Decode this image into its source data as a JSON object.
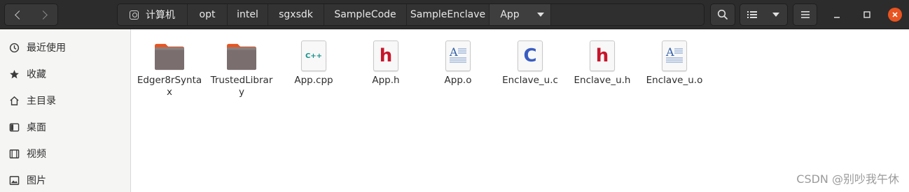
{
  "header": {
    "breadcrumbs": [
      "计算机",
      "opt",
      "intel",
      "sgxsdk",
      "SampleCode",
      "SampleEnclave",
      "App"
    ],
    "icons": {
      "back": "chevron-left-icon",
      "forward": "chevron-right-icon",
      "location_menu": "caret-down-icon",
      "search": "search-icon",
      "view": "list-view-icon",
      "view_menu": "caret-down-icon",
      "menu": "hamburger-menu-icon",
      "minimize": "minimize-icon",
      "maximize": "maximize-icon",
      "close": "close-icon"
    },
    "close_color": "#e95420"
  },
  "sidebar": {
    "items": [
      {
        "label": "最近使用",
        "icon": "clock-icon"
      },
      {
        "label": "收藏",
        "icon": "star-icon"
      },
      {
        "label": "主目录",
        "icon": "home-icon"
      },
      {
        "label": "桌面",
        "icon": "desktop-icon"
      },
      {
        "label": "视频",
        "icon": "video-icon"
      },
      {
        "label": "图片",
        "icon": "picture-icon"
      }
    ]
  },
  "files": [
    {
      "name": "Edger8rSyntax",
      "type": "folder",
      "icon": "folder-icon"
    },
    {
      "name": "TrustedLibrary",
      "type": "folder",
      "icon": "folder-icon"
    },
    {
      "name": "App.cpp",
      "type": "cpp",
      "icon": "cpp-file-icon",
      "glyph": "C++"
    },
    {
      "name": "App.h",
      "type": "header",
      "icon": "header-file-icon",
      "glyph": "h"
    },
    {
      "name": "App.o",
      "type": "object",
      "icon": "object-file-icon",
      "glyph": "A"
    },
    {
      "name": "Enclave_u.c",
      "type": "c",
      "icon": "c-file-icon",
      "glyph": "C"
    },
    {
      "name": "Enclave_u.h",
      "type": "header",
      "icon": "header-file-icon",
      "glyph": "h"
    },
    {
      "name": "Enclave_u.o",
      "type": "object",
      "icon": "object-file-icon",
      "glyph": "A"
    }
  ],
  "colors": {
    "folder": "#7a6e6e",
    "folder_tab": "#e95420",
    "header_glyph": "#c7162b",
    "c_glyph": "#3a5dc2",
    "cpp_glyph": "#17918a",
    "object_glyph": "#2f5fa8"
  },
  "watermark": "CSDN @别吵我午休"
}
